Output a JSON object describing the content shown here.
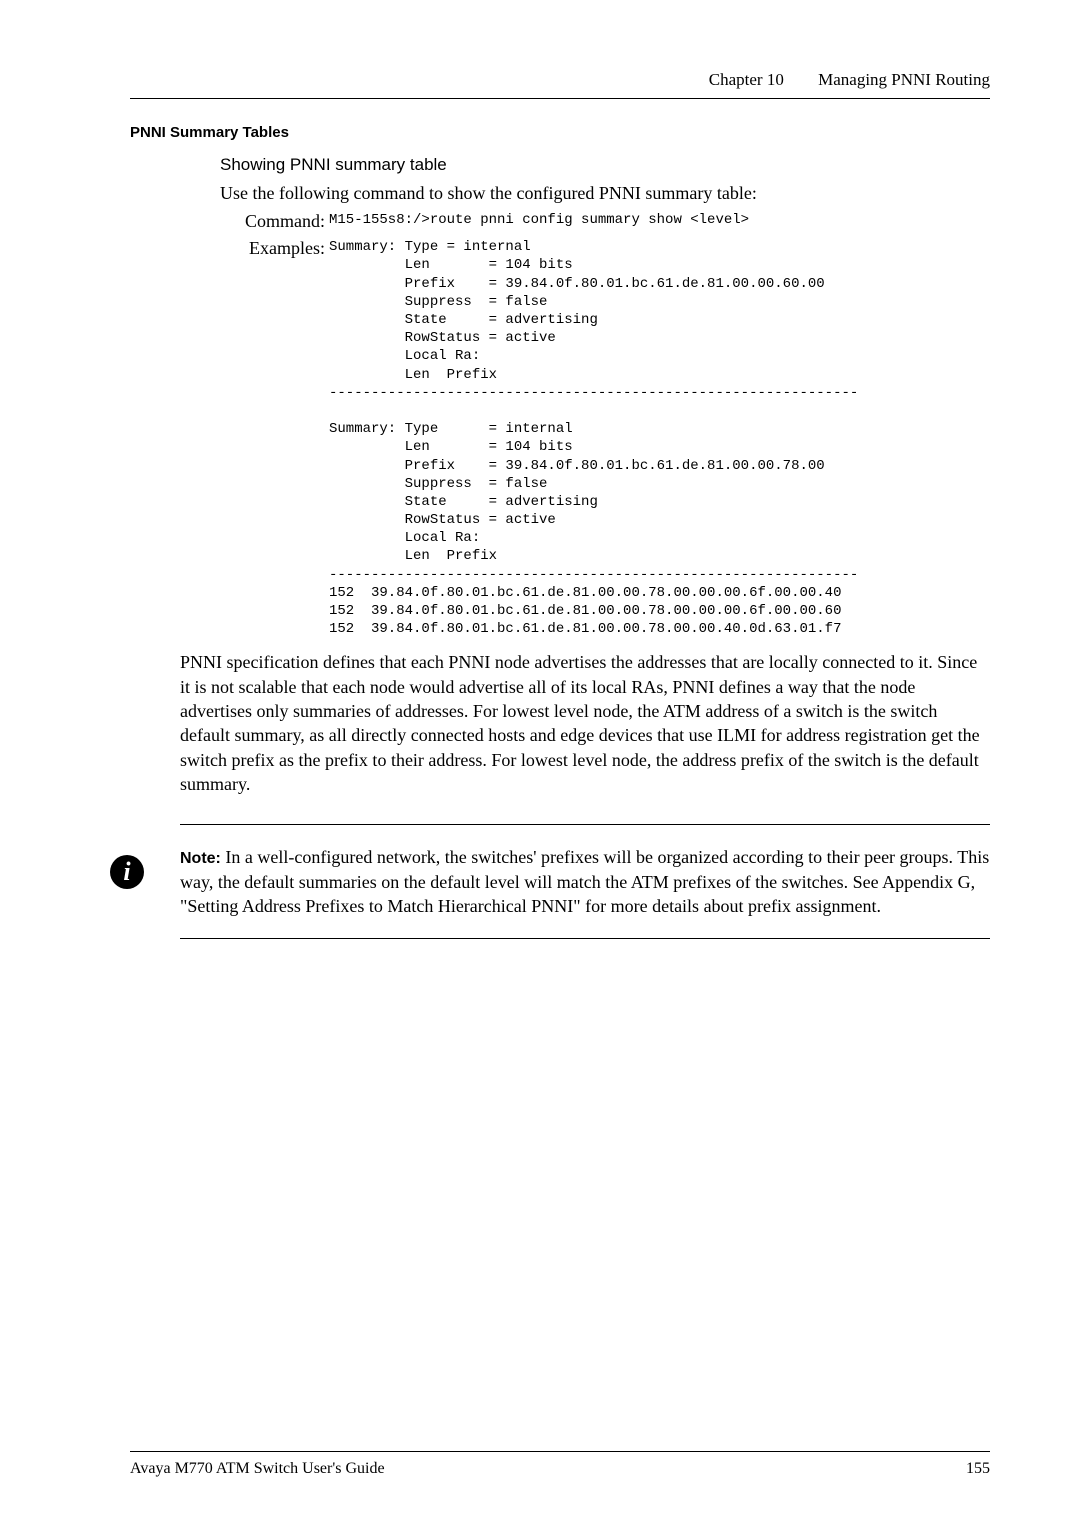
{
  "header": {
    "chapter": "Chapter 10",
    "title": "Managing PNNI Routing"
  },
  "section_title": "PNNI Summary Tables",
  "subheading": "Showing PNNI summary table",
  "intro": "Use the following command to show the configured PNNI summary table:",
  "labels": {
    "command": "Command:",
    "examples": "Examples:"
  },
  "command_line": "M15-155s8:/>route pnni config summary show <level>",
  "example_block": "Summary: Type = internal\n         Len       = 104 bits\n         Prefix    = 39.84.0f.80.01.bc.61.de.81.00.00.60.00\n         Suppress  = false\n         State     = advertising\n         RowStatus = active\n         Local Ra:\n         Len  Prefix\n---------------------------------------------------------------\n\nSummary: Type      = internal\n         Len       = 104 bits\n         Prefix    = 39.84.0f.80.01.bc.61.de.81.00.00.78.00\n         Suppress  = false\n         State     = advertising\n         RowStatus = active\n         Local Ra:\n         Len  Prefix\n---------------------------------------------------------------\n152  39.84.0f.80.01.bc.61.de.81.00.00.78.00.00.00.6f.00.00.40\n152  39.84.0f.80.01.bc.61.de.81.00.00.78.00.00.00.6f.00.00.60\n152  39.84.0f.80.01.bc.61.de.81.00.00.78.00.00.40.0d.63.01.f7",
  "spec_paragraph": "PNNI specification defines that each PNNI node advertises the addresses that are locally connected to it. Since it is not scalable that each node would advertise all of its local RAs, PNNI defines a way that the node advertises only summaries of addresses. For lowest level node, the ATM address of a switch is the switch default summary, as all directly connected hosts and edge devices that use ILMI for address registration get the switch prefix as the prefix to their address. For lowest level node, the address prefix of the switch is the default summary.",
  "note": {
    "icon": "i",
    "label": "Note:",
    "text": " In a well-configured network, the switches' prefixes will be organized according to their peer groups. This way, the default summaries on the default level will match the ATM prefixes of the switches. See Appendix G, \"Setting Address Prefixes to Match Hierarchical PNNI\" for more details about prefix assignment."
  },
  "footer": {
    "guide": "Avaya M770 ATM Switch User's Guide",
    "page": "155"
  }
}
